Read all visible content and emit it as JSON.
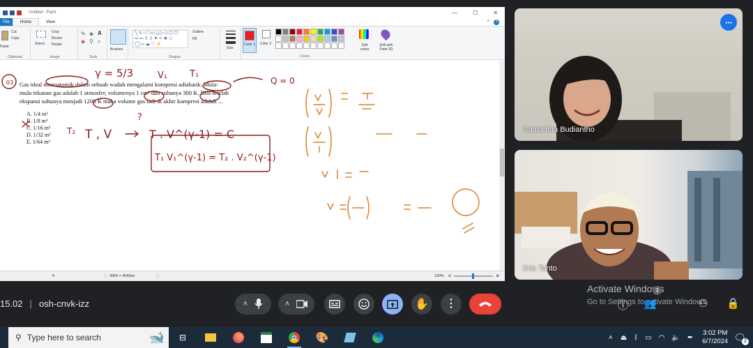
{
  "paint": {
    "title": "Untitled - Paint",
    "tabs": {
      "file": "File",
      "home": "Home",
      "view": "View"
    },
    "ribbon": {
      "clipboard": {
        "paste": "Paste",
        "cut": "Cut",
        "copy": "Copy",
        "group": "Clipboard"
      },
      "image": {
        "select": "Select",
        "crop": "Crop",
        "resize": "Resize",
        "rotate": "Rotate",
        "group": "Image"
      },
      "tools": {
        "group": "Tools"
      },
      "brushes": "Brushes",
      "shapes": {
        "outline": "Outline",
        "fill": "Fill",
        "group": "Shapes"
      },
      "size": "Size",
      "color1": "Color 1",
      "color2": "Color 2",
      "colors_group": "Colors",
      "edit_colors": "Edit colors",
      "edit_paint3d": "Edit with Paint 3D"
    },
    "palette": [
      "#000000",
      "#7f7f7f",
      "#880015",
      "#ed1c24",
      "#ff7f27",
      "#fff200",
      "#22b14c",
      "#00a2e8",
      "#3f48cc",
      "#a349a4",
      "#ffffff",
      "#c3c3c3",
      "#b97a57",
      "#ffaec9",
      "#ffc90e",
      "#efe4b0",
      "#b5e61d",
      "#99d9ea",
      "#7092be",
      "#c8bfe7",
      "#ffffff",
      "#ffffff",
      "#ffffff",
      "#ffffff",
      "#ffffff",
      "#ffffff",
      "#ffffff",
      "#ffffff",
      "#ffffff",
      "#ffffff"
    ],
    "color1_hex": "#ed1c24",
    "problem": {
      "number": "03",
      "line1": "Gas ideal monoatomik dalam sebuah wadah mengalami kompresi adiabatik. Mula-",
      "line2": "mula tekanan gas adalah 1 atmosfer, volumenya 1 cm³ dan suhunya 300 K. Bila setelah",
      "line3": "ekspansi suhunya menjadi 1200 K maka volume gas tadi di akhir kompresi adalah ...",
      "options": [
        {
          "letter": "A.",
          "text": "1/4 m³"
        },
        {
          "letter": "B.",
          "text": "1/8 m³"
        },
        {
          "letter": "C.",
          "text": "1/16 m³"
        },
        {
          "letter": "D.",
          "text": "1/32 m³"
        },
        {
          "letter": "E.",
          "text": "1/64 m³"
        }
      ]
    },
    "annotations": {
      "gamma": "γ = 5/3",
      "v1": "V₁",
      "t1": "T₁",
      "q0": "Q = 0",
      "t2": "T₂",
      "tv": "T , V",
      "tvgamma": "T . V^(γ-1) = C",
      "boxed": "T₁ V₁^(γ-1) = T₂ . V₂^(γ-1)",
      "question_mark": "?"
    },
    "status": {
      "size": "3064 × 4040px",
      "zoom": "100%"
    }
  },
  "participants": [
    {
      "name": "Samantha Budiantho"
    },
    {
      "name": "Kris Tanto"
    }
  ],
  "meeting": {
    "time": "15.02",
    "code": "osh-cnvk-izz",
    "participant_count": "3"
  },
  "watermark": {
    "line1": "Activate Windows",
    "line2": "Go to Settings to activate Windows."
  },
  "taskbar": {
    "search_placeholder": "Type here to search",
    "time": "3:02 PM",
    "date": "6/7/2024",
    "notifications": "2"
  }
}
